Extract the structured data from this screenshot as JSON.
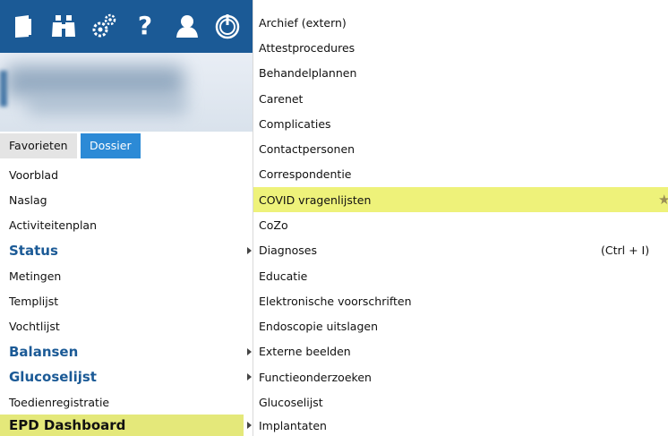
{
  "toolbar": {
    "icons": [
      "document-icon",
      "binoculars-icon",
      "settings-gears-icon",
      "help-icon",
      "user-icon",
      "power-icon"
    ],
    "help_glyph": "?"
  },
  "tabs": [
    {
      "label": "Favorieten",
      "active": false
    },
    {
      "label": "Dossier",
      "active": true
    }
  ],
  "nav": {
    "items": [
      {
        "label": "Voorblad"
      },
      {
        "label": "Naslag"
      },
      {
        "label": "Activiteitenplan"
      },
      {
        "label": "Status",
        "submenu": true
      },
      {
        "label": "Metingen"
      },
      {
        "label": "Templijst"
      },
      {
        "label": "Vochtlijst"
      },
      {
        "label": "Balansen",
        "submenu": true
      },
      {
        "label": "Glucoselijst",
        "submenu": true
      },
      {
        "label": "Toedienregistratie"
      },
      {
        "label": "EPD Dashboard",
        "submenu": true,
        "active": true
      }
    ]
  },
  "menu": {
    "items": [
      {
        "label": "Archief (extern)"
      },
      {
        "label": "Attestprocedures"
      },
      {
        "label": "Behandelplannen"
      },
      {
        "label": "Carenet"
      },
      {
        "label": "Complicaties"
      },
      {
        "label": "Contactpersonen"
      },
      {
        "label": "Correspondentie"
      },
      {
        "label": "COVID vragenlijsten",
        "highlighted": true,
        "starred": true
      },
      {
        "label": "CoZo"
      },
      {
        "label": "Diagnoses",
        "shortcut": "(Ctrl + I)"
      },
      {
        "label": "Educatie"
      },
      {
        "label": "Elektronische voorschriften"
      },
      {
        "label": "Endoscopie uitslagen"
      },
      {
        "label": "Externe beelden"
      },
      {
        "label": "Functieonderzoeken"
      },
      {
        "label": "Glucoselijst"
      },
      {
        "label": "Implantaten"
      }
    ],
    "star_glyph": "★"
  },
  "colors": {
    "toolbar": "#1b5a96",
    "tab_active": "#2c8ad6",
    "highlight": "#eef27a",
    "nav_active": "#e4e87a"
  }
}
